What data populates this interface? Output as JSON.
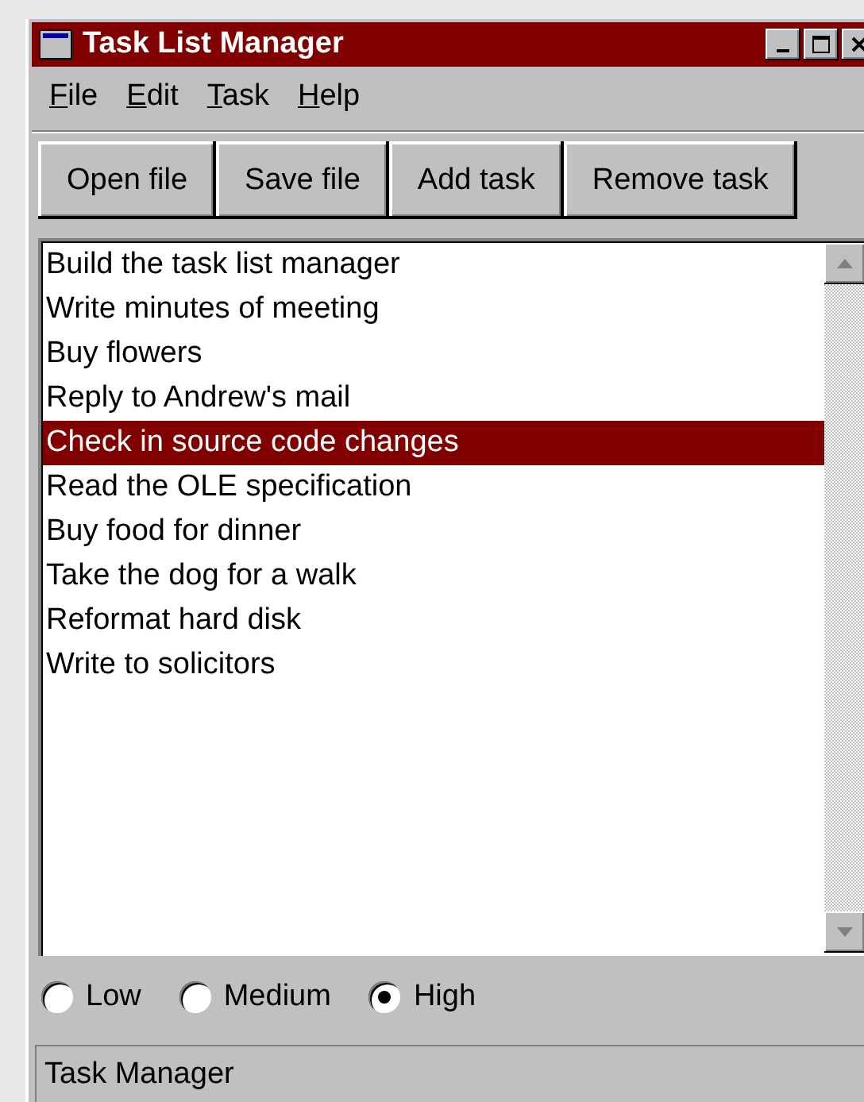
{
  "window": {
    "title": "Task List Manager"
  },
  "menu": [
    "File",
    "Edit",
    "Task",
    "Help"
  ],
  "toolbar": [
    "Open file",
    "Save file",
    "Add task",
    "Remove task"
  ],
  "tasks": [
    {
      "label": "Build the task list manager",
      "selected": false
    },
    {
      "label": "Write minutes of meeting",
      "selected": false
    },
    {
      "label": "Buy flowers",
      "selected": false
    },
    {
      "label": "Reply to Andrew's mail",
      "selected": false
    },
    {
      "label": "Check in source code changes",
      "selected": true
    },
    {
      "label": "Read the OLE specification",
      "selected": false
    },
    {
      "label": "Buy food for dinner",
      "selected": false
    },
    {
      "label": "Take the dog for a walk",
      "selected": false
    },
    {
      "label": "Reformat hard disk",
      "selected": false
    },
    {
      "label": "Write to solicitors",
      "selected": false
    }
  ],
  "priority": [
    {
      "label": "Low",
      "selected": false
    },
    {
      "label": "Medium",
      "selected": false
    },
    {
      "label": "High",
      "selected": true
    }
  ],
  "status_bar": "Task Manager"
}
